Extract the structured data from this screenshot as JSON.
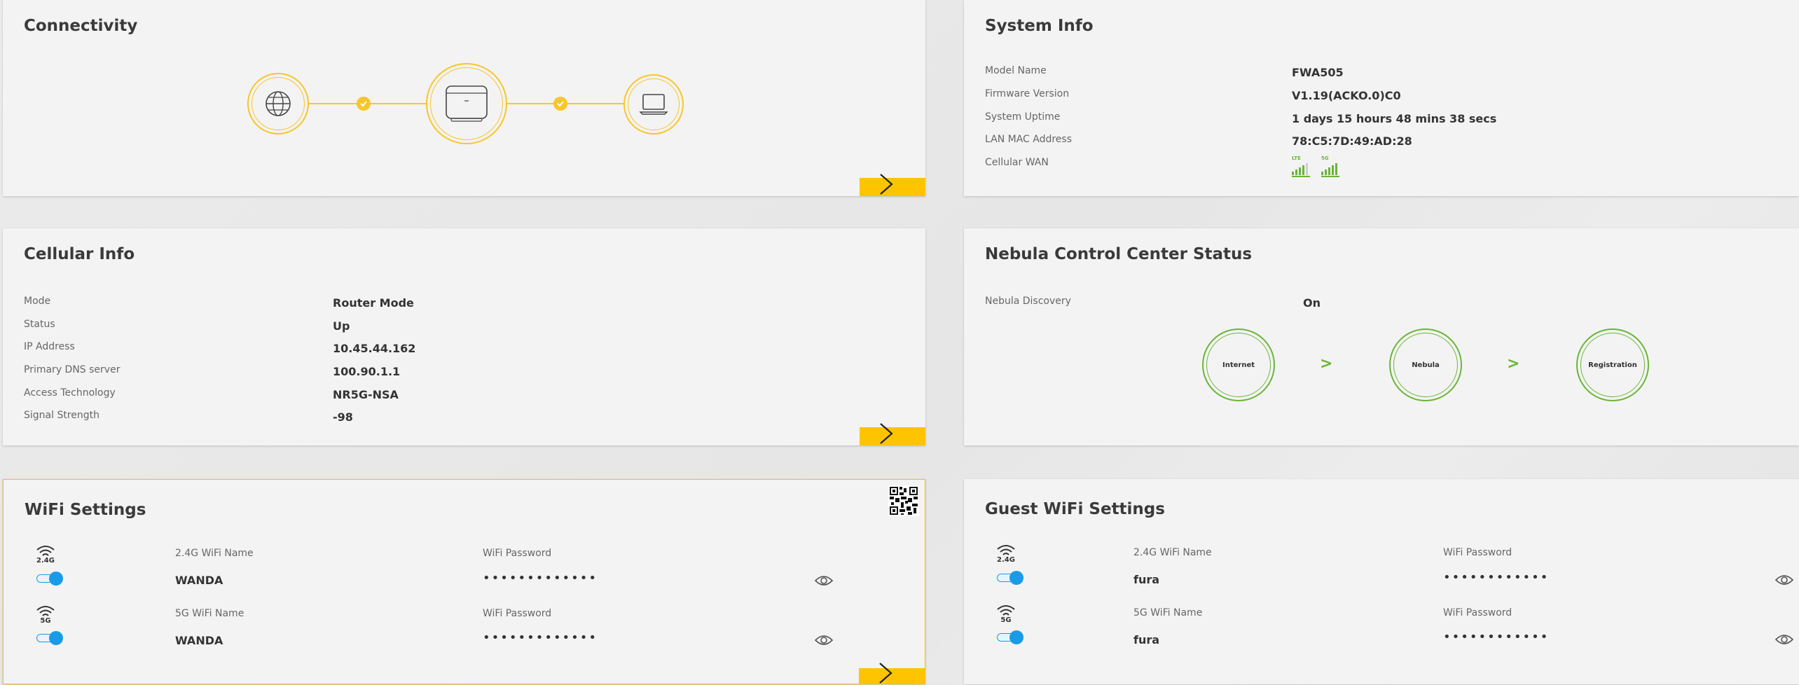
{
  "connectivity": {
    "title": "Connectivity"
  },
  "system_info": {
    "title": "System Info",
    "rows": [
      {
        "label": "Model Name",
        "value": "FWA505"
      },
      {
        "label": "Firmware Version",
        "value": "V1.19(ACKO.0)C0"
      },
      {
        "label": "System Uptime",
        "value": "1 days 15 hours 48 mins 38 secs"
      },
      {
        "label": "LAN MAC Address",
        "value": "78:C5:7D:49:AD:28"
      },
      {
        "label": "Cellular WAN",
        "value": ""
      }
    ],
    "cellular_badges": [
      "LTE",
      "5G"
    ]
  },
  "cellular_info": {
    "title": "Cellular Info",
    "rows": [
      {
        "label": "Mode",
        "value": "Router Mode"
      },
      {
        "label": "Status",
        "value": "Up"
      },
      {
        "label": "IP Address",
        "value": "10.45.44.162"
      },
      {
        "label": "Primary DNS server",
        "value": "100.90.1.1"
      },
      {
        "label": "Access Technology",
        "value": "NR5G-NSA"
      },
      {
        "label": "Signal Strength",
        "value": "-98"
      }
    ]
  },
  "nebula": {
    "title": "Nebula Control Center Status",
    "discovery_label": "Nebula Discovery",
    "discovery_value": "On",
    "steps": [
      "Internet",
      "Nebula",
      "Registration"
    ],
    "separator": ">"
  },
  "wifi": {
    "title": "WiFi Settings",
    "rows": [
      {
        "band": "2.4G",
        "name_label": "2.4G WiFi Name",
        "name": "WANDA",
        "pw_label": "WiFi Password",
        "pw": "•••••••••••••"
      },
      {
        "band": "5G",
        "name_label": "5G WiFi Name",
        "name": "WANDA",
        "pw_label": "WiFi Password",
        "pw": "•••••••••••••"
      }
    ]
  },
  "guest_wifi": {
    "title": "Guest WiFi Settings",
    "rows": [
      {
        "band": "2.4G",
        "name_label": "2.4G WiFi Name",
        "name": "fura",
        "pw_label": "WiFi Password",
        "pw": "••••••••••••"
      },
      {
        "band": "5G",
        "name_label": "5G WiFi Name",
        "name": "fura",
        "pw_label": "WiFi Password",
        "pw": "••••••••••••"
      }
    ]
  },
  "colors": {
    "accent": "#ffc400",
    "ok": "#6ab537",
    "toggle": "#1a9be8"
  }
}
